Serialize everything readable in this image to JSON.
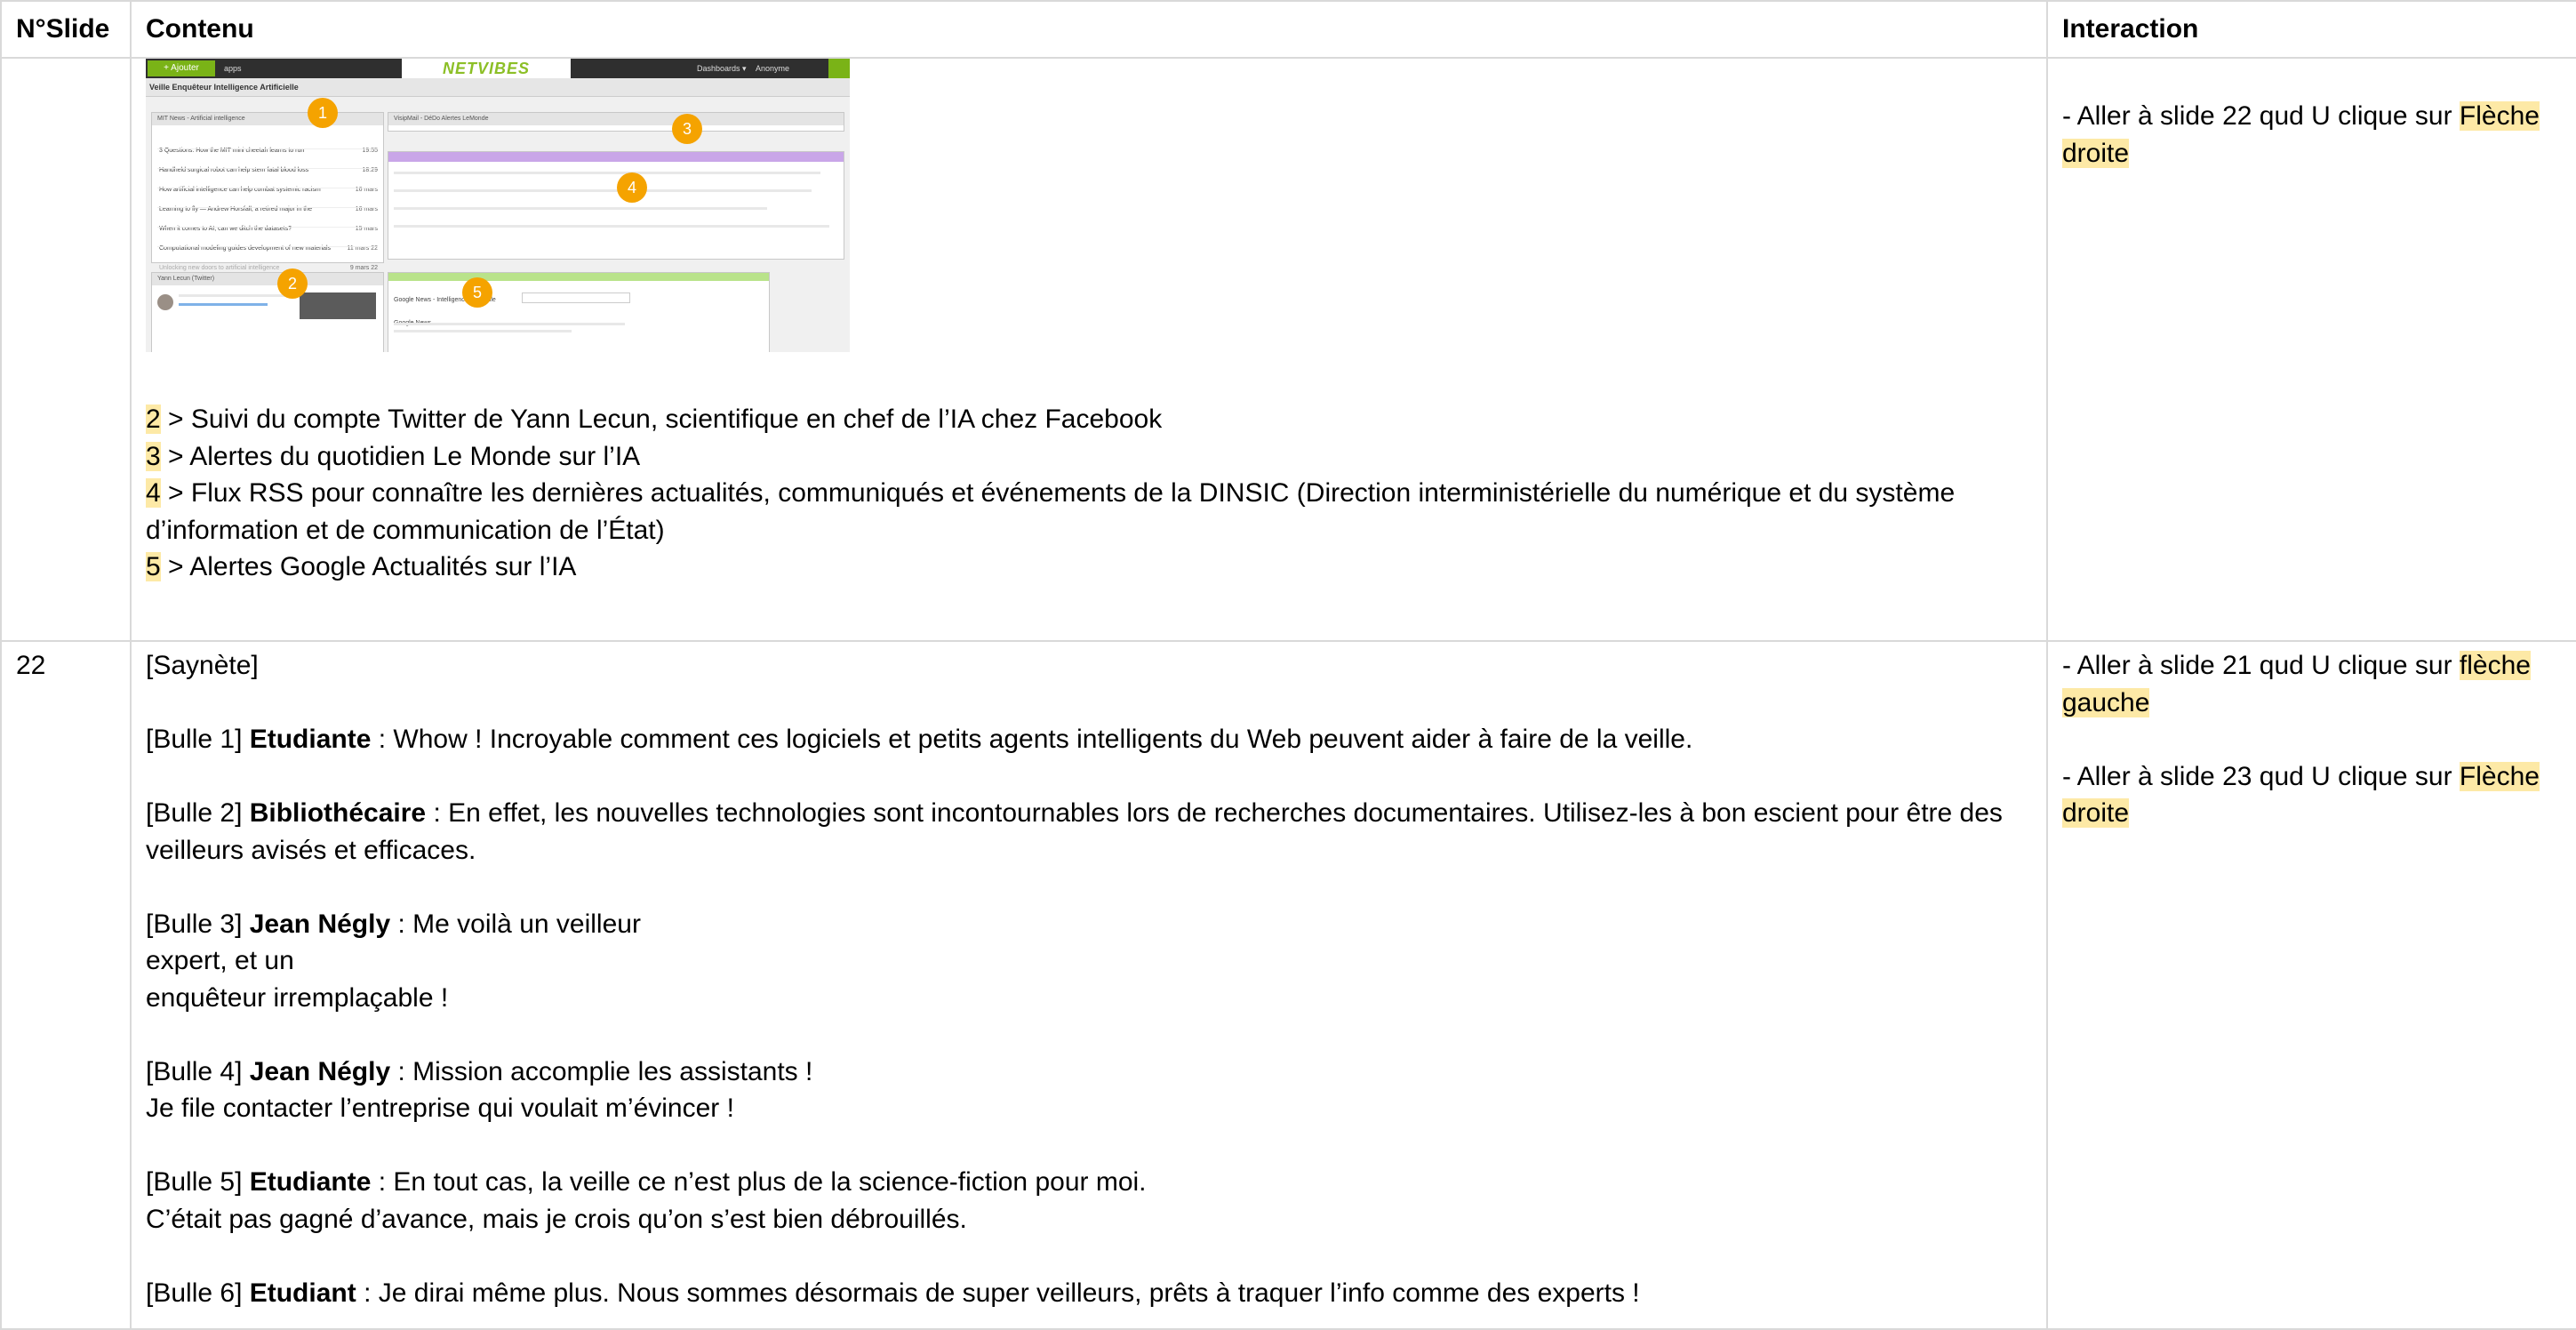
{
  "table": {
    "headers": [
      "N°Slide",
      "Contenu",
      "Interaction"
    ]
  },
  "screenshot": {
    "add_button": "+ Ajouter",
    "apps_label": "apps",
    "logo": "NETVIBES",
    "dashboards": "Dashboards ▾",
    "user": "Anonyme",
    "tab_title": "Veille Enquêteur Intelligence Artificielle",
    "widget1_title": "MIT News - Artificial intelligence",
    "widget1_items": [
      {
        "text": "3 Questions: How the MIT mini cheetah learns to run",
        "date": "19:55"
      },
      {
        "text": "Handheld surgical robot can help stem fatal blood loss",
        "date": "18:29"
      },
      {
        "text": "How artificial intelligence can help combat systemic racism",
        "date": "16 mars"
      },
      {
        "text": "Learning to fly — Andrew Horsfall, a retired major in the",
        "date": "16 mars"
      },
      {
        "text": "When it comes to AI, can we ditch the datasets?",
        "date": "15 mars"
      },
      {
        "text": "Computational modeling guides development of new materials",
        "date": "11 mars 22"
      },
      {
        "text": "Unlocking new doors to artificial intelligence",
        "date": "9 mars 22"
      }
    ],
    "widget2_title": "Yann Lecun (Twitter)",
    "widget3_title": "VisipMail - DéDo Alertes LeMonde",
    "widget4_title": "Google News - Intelligence artificielle",
    "google_news_label": "Google News",
    "badges": [
      "1",
      "2",
      "3",
      "4",
      "5"
    ]
  },
  "row21": {
    "items": [
      {
        "num": "2",
        "text": " > Suivi du compte Twitter de Yann Lecun, scientifique en chef de l’IA chez Facebook"
      },
      {
        "num": "3",
        "text": " > Alertes du quotidien Le Monde sur l’IA"
      },
      {
        "num": "4",
        "text": " > Flux RSS pour connaître les dernières actualités, communiqués et événements de la DINSIC (Direction interministérielle du numérique et du système d’information et de communication de l’État)"
      },
      {
        "num": "5",
        "text": " > Alertes Google Actualités sur l’IA"
      }
    ],
    "interaction": {
      "text": "- Aller à slide 22 qud U clique sur ",
      "highlight": "Flèche droite"
    }
  },
  "row22": {
    "slide": "22",
    "intro": "[Saynète]",
    "bubbles": [
      {
        "prefix": "[Bulle 1] ",
        "speaker": "Etudiante",
        "lines": [
          " : Whow ! Incroyable comment ces logiciels et petits agents intelligents du Web peuvent aider à faire de la veille."
        ]
      },
      {
        "prefix": "[Bulle 2] ",
        "speaker": "Bibliothécaire",
        "lines": [
          " : En effet, les nouvelles technologies sont incontournables lors de recherches documentaires. Utilisez-les à bon escient pour être des veilleurs avisés et efficaces."
        ]
      },
      {
        "prefix": "[Bulle 3] ",
        "speaker": "Jean Négly",
        "lines": [
          " : Me voilà un veilleur",
          "expert, et un",
          "enquêteur irremplaçable !"
        ]
      },
      {
        "prefix": "[Bulle 4] ",
        "speaker": "Jean Négly",
        "lines": [
          " : Mission accomplie les assistants !",
          "Je file contacter l’entreprise qui voulait m’évincer !"
        ]
      },
      {
        "prefix": "[Bulle 5] ",
        "speaker": "Etudiante",
        "lines": [
          " : En tout cas, la veille ce n’est plus de la science-fiction pour moi.",
          "C’était pas gagné d’avance, mais je crois qu’on s’est bien débrouillés."
        ]
      },
      {
        "prefix": "[Bulle 6] ",
        "speaker": "Etudiant",
        "lines": [
          " : Je dirai même plus. Nous sommes désormais de super veilleurs, prêts à traquer l’info comme des experts !"
        ]
      }
    ],
    "interactions": [
      {
        "text": "- Aller à slide 21 qud U clique sur ",
        "highlight": "flèche gauche"
      },
      {
        "text": "- Aller à slide 23 qud U clique sur ",
        "highlight": "Flèche droite"
      }
    ]
  }
}
